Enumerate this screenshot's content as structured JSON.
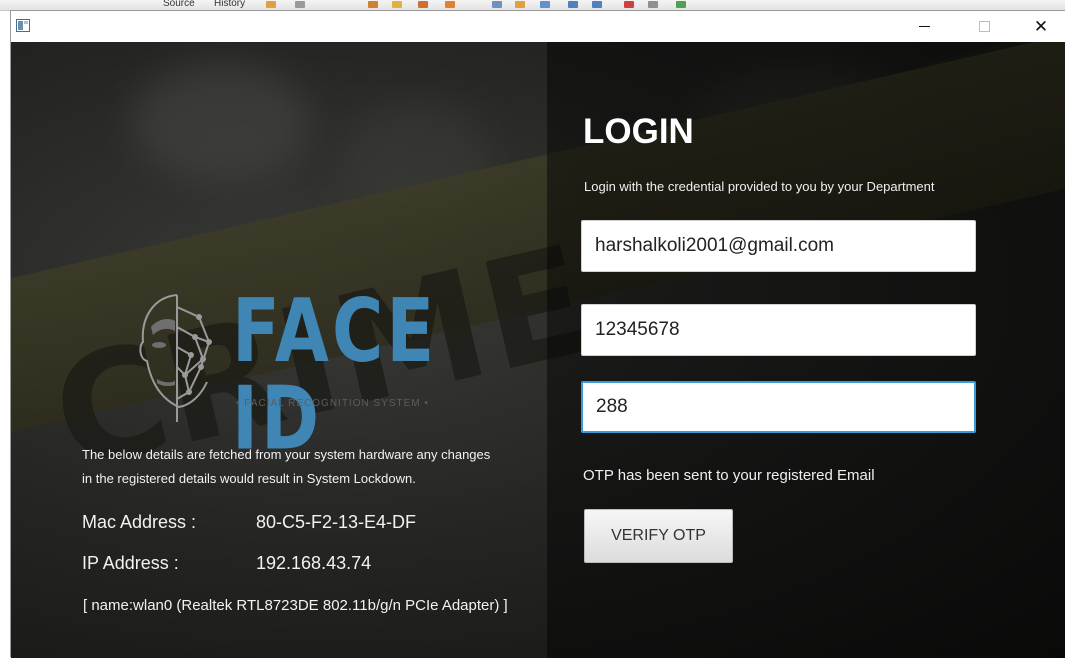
{
  "ide_strip": {
    "tab_source": "Source",
    "tab_history": "History"
  },
  "window": {
    "min_icon": "minimize-icon",
    "max_icon": "maximize-icon",
    "close_icon": "close-icon",
    "close_glyph": "✕"
  },
  "logo": {
    "title": "FACE ID",
    "subtitle": "• FACIAL RECOGNITION SYSTEM •",
    "brand_color": "#3f86b4"
  },
  "system_info": {
    "notice": "The below details are fetched from your system hardware any changes in the registered details would result in System Lockdown.",
    "mac_label": "Mac Address :",
    "mac_value": "80-C5-F2-13-E4-DF",
    "ip_label": "IP Address   :",
    "ip_value": "192.168.43.74",
    "adapter": "[ name:wlan0 (Realtek RTL8723DE 802.11b/g/n PCIe Adapter) ]"
  },
  "login": {
    "title": "LOGIN",
    "subtitle": "Login with the credential provided to you by your Department",
    "email_value": "harshalkoli2001@gmail.com",
    "password_value": "12345678",
    "otp_value": "288",
    "otp_message": "OTP has been sent to your registered Email",
    "verify_label": "VERIFY OTP",
    "focus_color": "#3a9ad9"
  }
}
